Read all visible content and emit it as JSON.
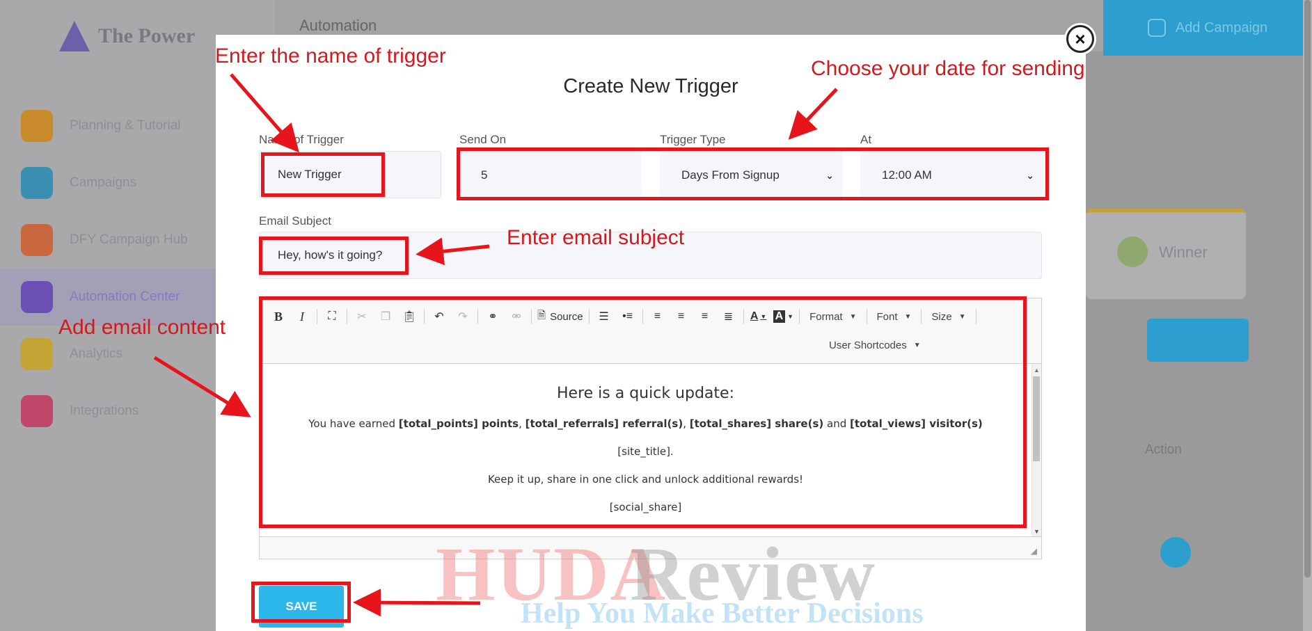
{
  "background": {
    "app_name": "The Power",
    "topbar_title": "Automation",
    "add_button_label": "Add Campaign",
    "nav_items": [
      {
        "label": "Planning & Tutorial",
        "color": "#c98a2c"
      },
      {
        "label": "Campaigns",
        "color": "#3a8fb3"
      },
      {
        "label": "DFY Campaign Hub",
        "color": "#c9673f"
      },
      {
        "label": "Automation Center",
        "color": "#6b4fb5"
      },
      {
        "label": "Analytics",
        "color": "#c2a335"
      },
      {
        "label": "Integrations",
        "color": "#c0466a"
      }
    ],
    "right_card_label": "Winner",
    "right_label2": "Action"
  },
  "modal": {
    "title": "Create New Trigger",
    "close_label": "×",
    "name_label": "Name of Trigger",
    "name_value": "New Trigger",
    "send_on_label": "Send On",
    "send_on_value": "5",
    "trigger_type_label": "Trigger Type",
    "trigger_type_value": "Days From Signup",
    "at_label": "At",
    "at_value": "12:00 AM",
    "subject_label": "Email Subject",
    "subject_value": "Hey, how's it going?",
    "save_label": "SAVE"
  },
  "editor": {
    "toolbar": {
      "source_label": "Source",
      "format_label": "Format",
      "font_label": "Font",
      "size_label": "Size",
      "shortcodes_label": "User Shortcodes"
    },
    "content": {
      "heading": "Here is a quick update:",
      "line1_a": "You have earned ",
      "line1_b": "[total_points] points",
      "line1_c": ", ",
      "line1_d": "[total_referrals] referral(s)",
      "line1_e": ", ",
      "line1_f": "[total_shares] share(s)",
      "line1_g": " and ",
      "line1_h": "[total_views] visitor(s)",
      "line2": "[site_title].",
      "line3": "Keep it up, share in one click and unlock additional rewards!",
      "line4": "[social_share]"
    }
  },
  "annotations": {
    "name_hint": "Enter the name of trigger",
    "date_hint": "Choose your date for sending",
    "subject_hint": "Enter email subject",
    "content_hint": "Add email content",
    "color": "#e8141b"
  },
  "watermark": {
    "brand_a": "HUDA",
    "brand_b": "Review",
    "tagline": "Help You Make Better Decisions"
  }
}
